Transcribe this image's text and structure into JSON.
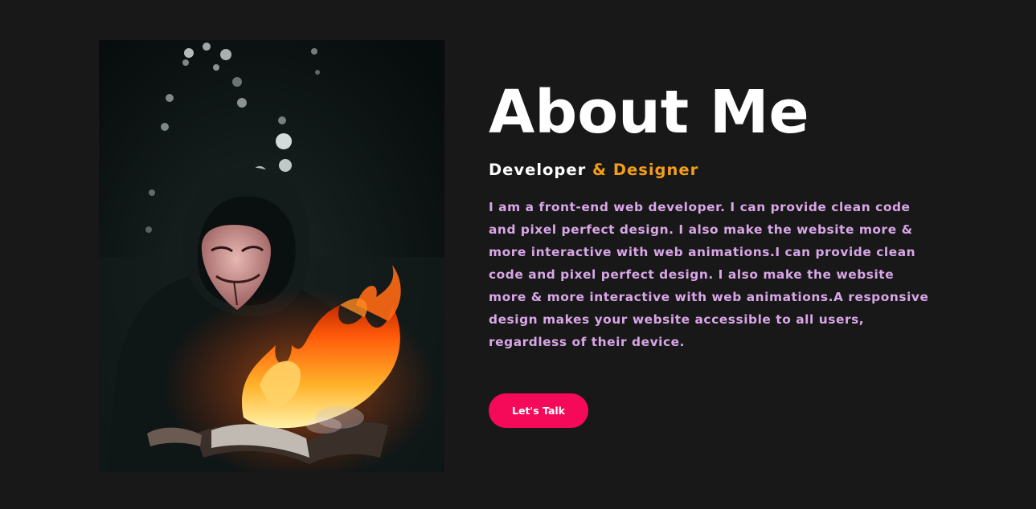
{
  "about": {
    "title": "About Me",
    "subtitle_part1": "Developer",
    "subtitle_part2": "& Designer",
    "bio": "I am a front-end web developer. I can provide clean code and pixel perfect design. I also make the website more & more interactive with web animations.I can provide clean code and pixel perfect design. I also make the website more & more interactive with web animations.A responsive design makes your website accessible to all users, regardless of their device.",
    "cta_label": "Let's Talk"
  },
  "colors": {
    "background": "#181818",
    "accent_orange": "#f59e1b",
    "accent_pink": "#f50a5a",
    "bio_text": "#d9a6e8"
  }
}
